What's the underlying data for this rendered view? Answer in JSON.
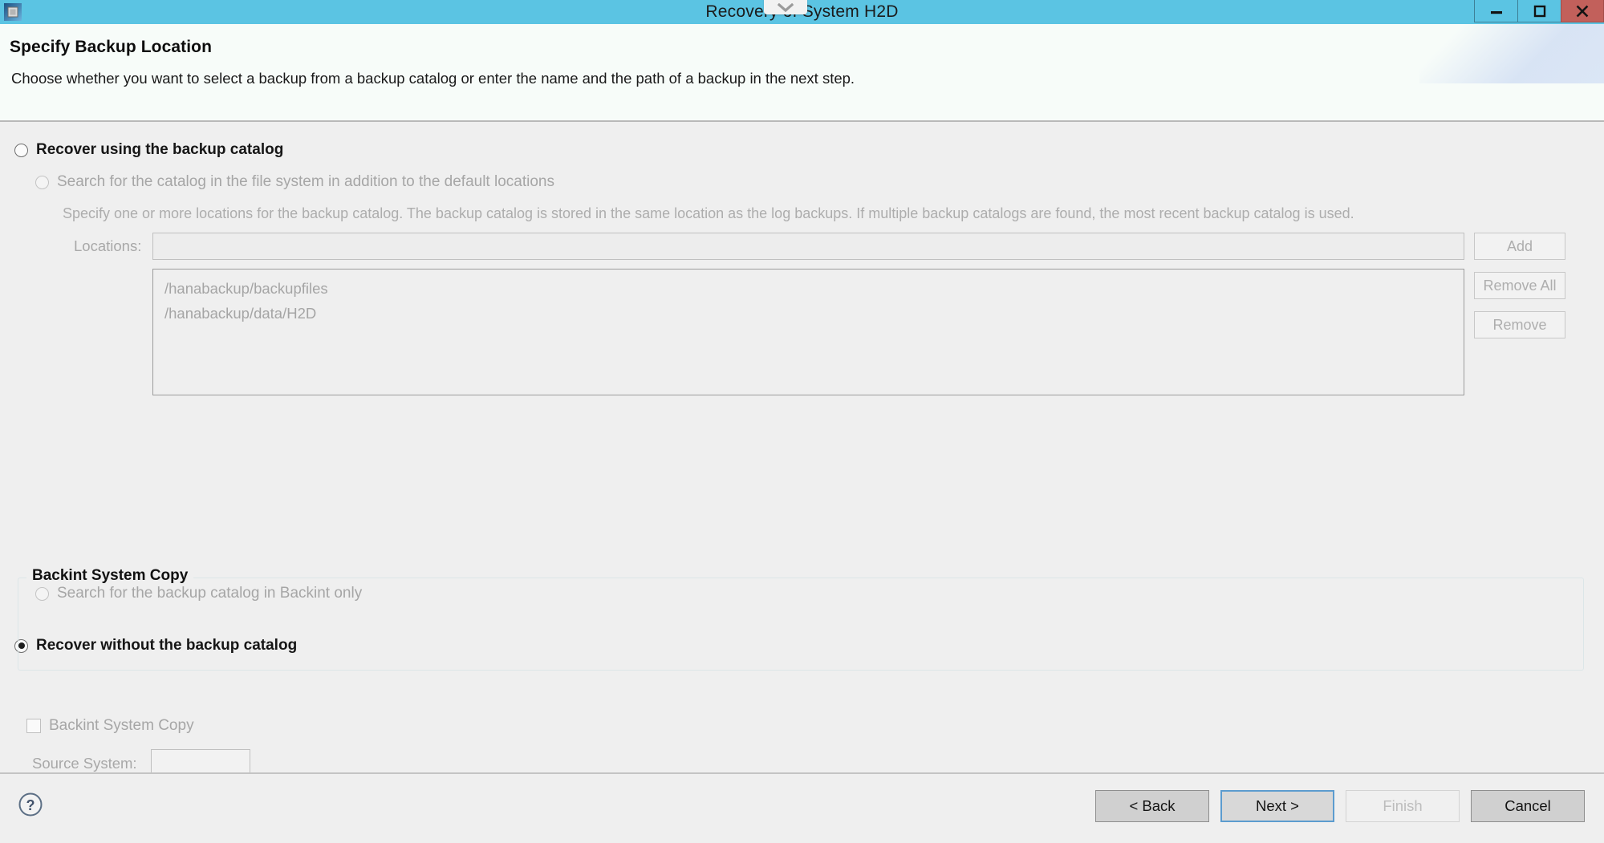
{
  "window": {
    "title": "Recovery of System H2D",
    "icon": "app-chip-icon",
    "dropdown_icon": "chevron-down-icon",
    "controls": {
      "minimize": "minimize-icon",
      "maximize": "maximize-icon",
      "close": "close-icon"
    },
    "titlebar_color": "#5bc4e3",
    "close_color": "#c2605b"
  },
  "header": {
    "title": "Specify Backup Location",
    "subtitle": "Choose whether you want to select a backup from a backup catalog or enter the name and the path of a backup in the next step."
  },
  "body": {
    "option_use_catalog": {
      "label": "Recover using the backup catalog",
      "selected": false,
      "enabled": true
    },
    "option_search_filesystem": {
      "label": "Search for the catalog in the file system in addition to the default locations",
      "selected": false,
      "enabled": false
    },
    "catalog_description": "Specify one or more locations for the backup catalog. The backup catalog is stored in the same location as the log backups. If multiple backup catalogs are found, the most recent backup catalog is used.",
    "locations": {
      "label": "Locations:",
      "value": "",
      "placeholder": "",
      "items": [
        "/hanabackup/backupfiles",
        "/hanabackup/data/H2D"
      ],
      "buttons": [
        {
          "label": "Add",
          "enabled": false
        },
        {
          "label": "Remove All",
          "enabled": false
        },
        {
          "label": "Remove",
          "enabled": false
        }
      ]
    },
    "option_backint_only": {
      "label": "Search for the backup catalog in Backint only",
      "selected": false,
      "enabled": false
    },
    "option_without_catalog": {
      "label": "Recover without the backup catalog",
      "selected": true,
      "enabled": true
    },
    "backint_group": {
      "title": "Backint System Copy",
      "checkbox_label": "Backint System Copy",
      "checked": false,
      "enabled": false,
      "source_system_label": "Source System:",
      "source_system_value": "",
      "source_system_placeholder": ""
    }
  },
  "footer": {
    "help_icon": "help-question-icon",
    "buttons": [
      {
        "label": "< Back",
        "state": "normal"
      },
      {
        "label": "Next >",
        "state": "focused"
      },
      {
        "label": "Finish",
        "state": "disabled"
      },
      {
        "label": "Cancel",
        "state": "normal"
      }
    ]
  }
}
